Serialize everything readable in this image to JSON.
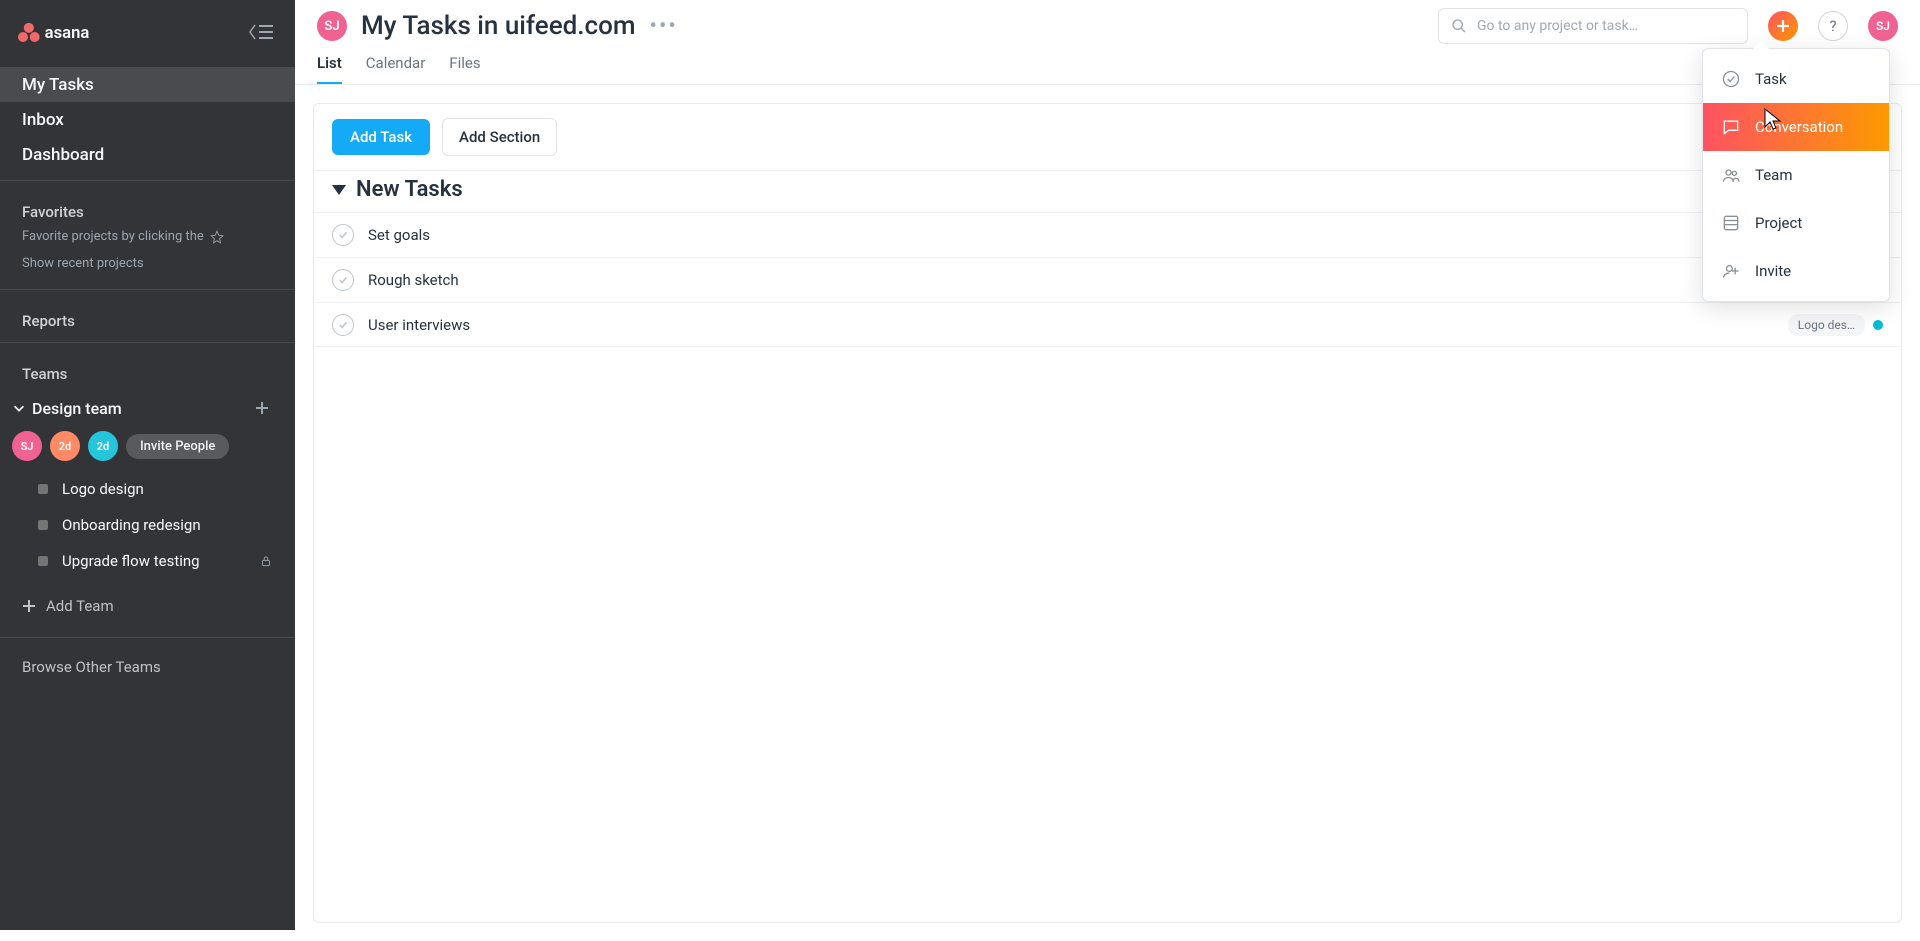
{
  "header": {
    "avatar_initials": "SJ",
    "title": "My Tasks in uifeed.com",
    "search_placeholder": "Go to any project or task…",
    "help_label": "?",
    "user_initials": "SJ"
  },
  "tabs": [
    {
      "label": "List",
      "active": true
    },
    {
      "label": "Calendar",
      "active": false
    },
    {
      "label": "Files",
      "active": false
    }
  ],
  "toolbar": {
    "add_task_label": "Add Task",
    "add_section_label": "Add Section"
  },
  "tasks_section": {
    "title": "New Tasks",
    "rows": [
      {
        "title": "Set goals",
        "chip": null,
        "dot": null
      },
      {
        "title": "Rough sketch",
        "chip": null,
        "dot": null
      },
      {
        "title": "User interviews",
        "chip": "Logo des…",
        "dot": "#00bcd4"
      }
    ]
  },
  "add_menu": {
    "items": [
      {
        "label": "Task",
        "icon": "check-circle-icon",
        "active": false
      },
      {
        "label": "Conversation",
        "icon": "chat-icon",
        "active": true
      },
      {
        "label": "Team",
        "icon": "team-icon",
        "active": false
      },
      {
        "label": "Project",
        "icon": "project-icon",
        "active": false
      },
      {
        "label": "Invite",
        "icon": "invite-icon",
        "active": false
      }
    ]
  },
  "sidebar": {
    "nav": [
      {
        "label": "My Tasks",
        "active": true
      },
      {
        "label": "Inbox",
        "active": false
      },
      {
        "label": "Dashboard",
        "active": false
      }
    ],
    "favorites_header": "Favorites",
    "favorites_hint": "Favorite projects by clicking the",
    "show_recent": "Show recent projects",
    "reports_header": "Reports",
    "teams_header": "Teams",
    "team": {
      "name": "Design team",
      "members": [
        {
          "initials": "SJ",
          "cls": "av-pink"
        },
        {
          "initials": "2d",
          "cls": "av-orange"
        },
        {
          "initials": "2d",
          "cls": "av-teal"
        }
      ],
      "invite_label": "Invite People",
      "projects": [
        {
          "name": "Logo design",
          "color": "#757575",
          "locked": false
        },
        {
          "name": "Onboarding redesign",
          "color": "#757575",
          "locked": false
        },
        {
          "name": "Upgrade flow testing",
          "color": "#757575",
          "locked": true
        }
      ]
    },
    "add_team_label": "Add Team",
    "browse_teams_label": "Browse Other Teams"
  }
}
